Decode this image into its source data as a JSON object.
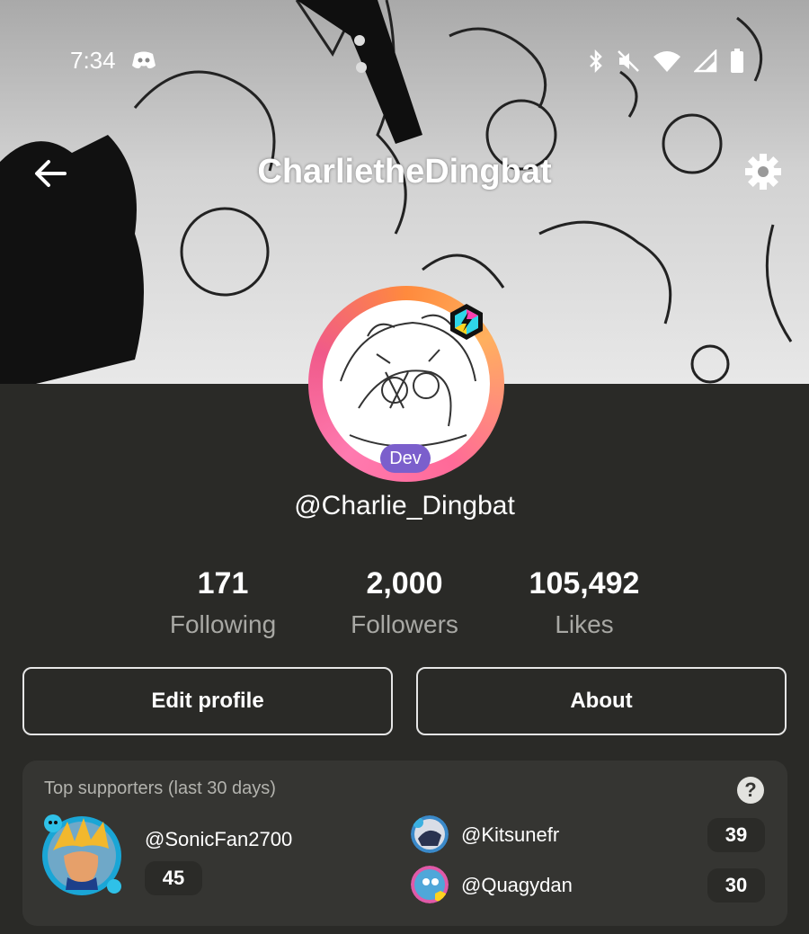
{
  "status_bar": {
    "time": "7:34"
  },
  "header": {
    "title": "CharlietheDingbat"
  },
  "profile": {
    "role_badge": "Dev",
    "username": "@Charlie_Dingbat"
  },
  "stats": [
    {
      "value": "171",
      "label": "Following"
    },
    {
      "value": "2,000",
      "label": "Followers"
    },
    {
      "value": "105,492",
      "label": "Likes"
    }
  ],
  "actions": {
    "edit_label": "Edit profile",
    "about_label": "About"
  },
  "supporters": {
    "title": "Top supporters (last 30 days)",
    "help": "?",
    "items": [
      {
        "name": "@SonicFan2700",
        "count": "45"
      },
      {
        "name": "@Kitsunefr",
        "count": "39"
      },
      {
        "name": "@Quagydan",
        "count": "30"
      }
    ]
  },
  "icons": [
    "discord-icon",
    "bluetooth-icon",
    "mute-icon",
    "wifi-icon",
    "signal-icon",
    "battery-icon",
    "back-arrow-icon",
    "gear-icon",
    "hex-badge-icon",
    "help-icon"
  ],
  "colors": {
    "background": "#2a2a27",
    "card": "#353532",
    "dev_badge": "#7b5fcc",
    "ring_start": "#ff8a3d",
    "ring_end": "#ff6a98"
  }
}
